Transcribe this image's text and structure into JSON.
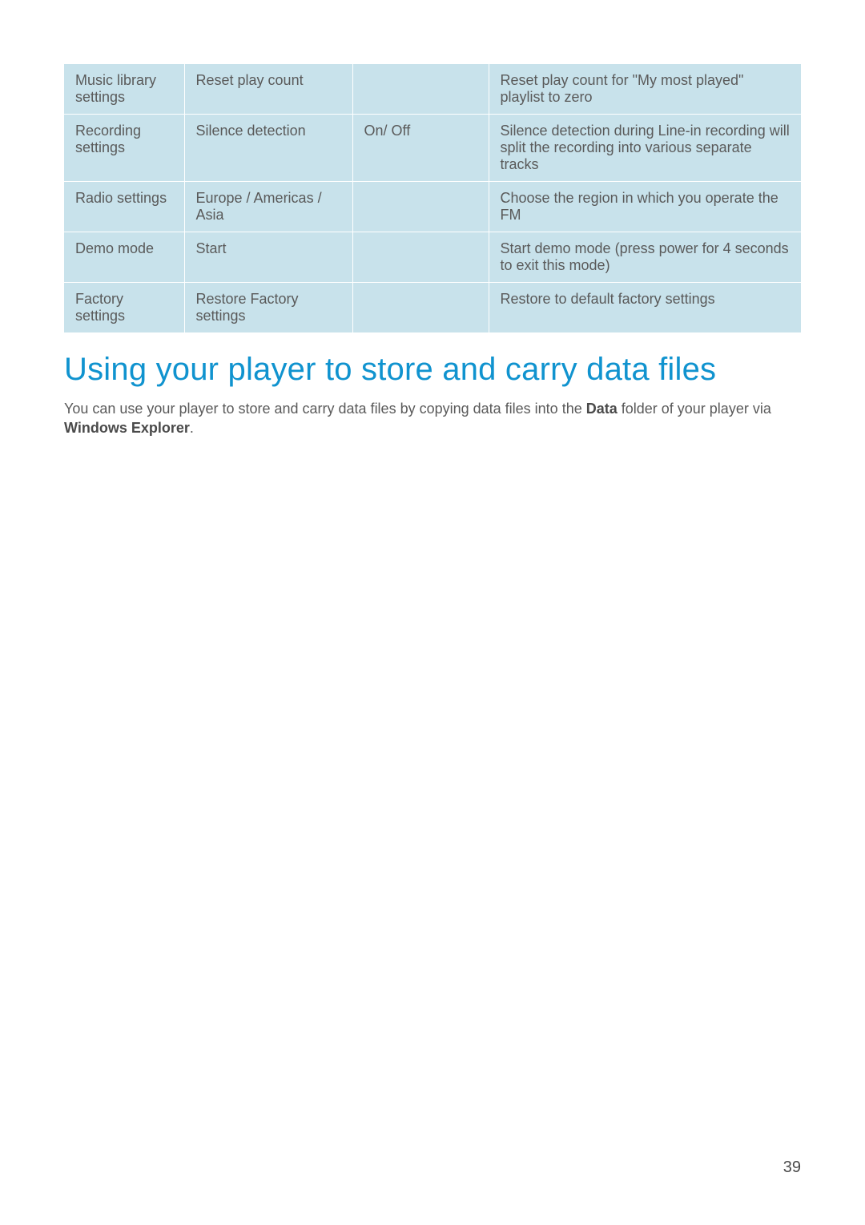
{
  "table": {
    "rows": [
      {
        "setting": "Music library settings",
        "option": "Reset play count",
        "value": "",
        "description": "Reset play count for \"My most played\" playlist to zero"
      },
      {
        "setting": "Recording settings",
        "option": "Silence detection",
        "value": "On/ Off",
        "description": "Silence detection during Line-in recording will split the recording into various separate tracks"
      },
      {
        "setting": "Radio settings",
        "option": "Europe / Americas / Asia",
        "value": "",
        "description": "Choose the region in which you operate the FM"
      },
      {
        "setting": "Demo mode",
        "option": "Start",
        "value": "",
        "description": "Start demo mode (press power for 4 seconds to exit this mode)"
      },
      {
        "setting": "Factory settings",
        "option": "Restore Factory settings",
        "value": "",
        "description": "Restore to default factory settings"
      }
    ]
  },
  "heading": "Using your player to store and carry data files",
  "paragraph": {
    "part1": "You can use your player to store and carry data files by copying data files into the ",
    "bold1": "Data",
    "part2": " folder of your player via ",
    "bold2": "Windows Explorer",
    "part3": "."
  },
  "page_number": "39"
}
